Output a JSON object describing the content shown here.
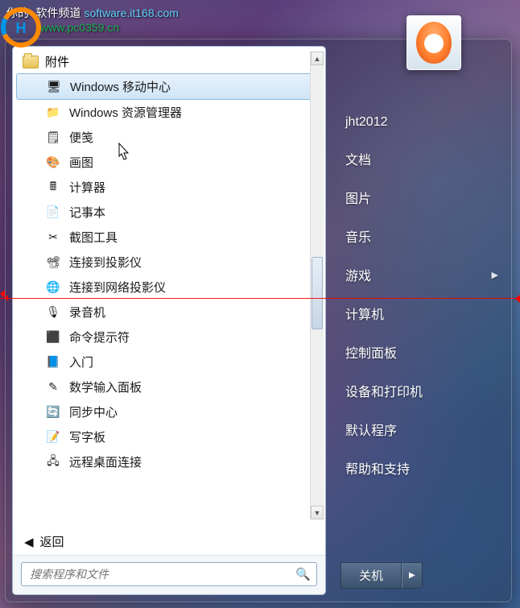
{
  "watermark": {
    "prefix": "你的· 软件频道 ",
    "url1": "software.it168.com",
    "url2": "www.pc0359.cn"
  },
  "folder_label": "附件",
  "programs": [
    {
      "label": "Windows 移动中心",
      "icon": "mobility",
      "hovered": true
    },
    {
      "label": "Windows 资源管理器",
      "icon": "explorer"
    },
    {
      "label": "便笺",
      "icon": "sticky"
    },
    {
      "label": "画图",
      "icon": "paint"
    },
    {
      "label": "计算器",
      "icon": "calc"
    },
    {
      "label": "记事本",
      "icon": "notepad"
    },
    {
      "label": "截图工具",
      "icon": "snip"
    },
    {
      "label": "连接到投影仪",
      "icon": "projector"
    },
    {
      "label": "连接到网络投影仪",
      "icon": "netprojector"
    },
    {
      "label": "录音机",
      "icon": "recorder"
    },
    {
      "label": "命令提示符",
      "icon": "cmd"
    },
    {
      "label": "入门",
      "icon": "getstarted"
    },
    {
      "label": "数学输入面板",
      "icon": "mathinput"
    },
    {
      "label": "同步中心",
      "icon": "sync"
    },
    {
      "label": "写字板",
      "icon": "wordpad"
    },
    {
      "label": "远程桌面连接",
      "icon": "rdp"
    }
  ],
  "back_label": "返回",
  "search_placeholder": "搜索程序和文件",
  "right_panel": {
    "username": "jht2012",
    "links": [
      {
        "label": "文档"
      },
      {
        "label": "图片"
      },
      {
        "label": "音乐"
      },
      {
        "label": "游戏",
        "expand": true
      },
      {
        "label": "计算机"
      },
      {
        "label": "控制面板"
      },
      {
        "label": "设备和打印机"
      },
      {
        "label": "默认程序"
      },
      {
        "label": "帮助和支持"
      }
    ]
  },
  "shutdown_label": "关机",
  "icon_glyphs": {
    "mobility": "🖥",
    "explorer": "📁",
    "sticky": "🗒",
    "paint": "🎨",
    "calc": "🖩",
    "notepad": "📄",
    "snip": "✂",
    "projector": "📽",
    "netprojector": "🌐",
    "recorder": "🎙",
    "cmd": "⬛",
    "getstarted": "📘",
    "mathinput": "✎",
    "sync": "🔄",
    "wordpad": "📝",
    "rdp": "🖧"
  }
}
